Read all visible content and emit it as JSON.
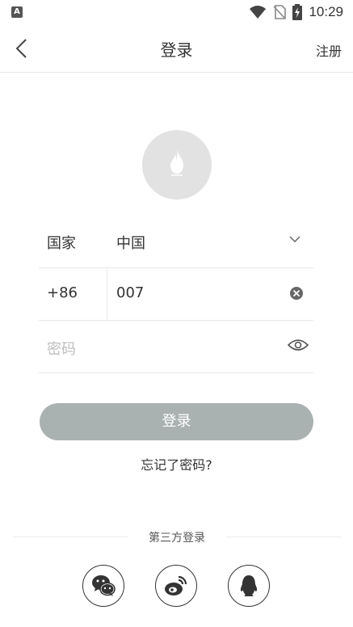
{
  "status_bar": {
    "app_badge": "A",
    "time": "10:29"
  },
  "nav": {
    "title": "登录",
    "register": "注册"
  },
  "form": {
    "country_label": "国家",
    "country_value": "中国",
    "phone_code": "+86",
    "phone_value": "007",
    "password_placeholder": "密码"
  },
  "login_button": "登录",
  "forgot_password": "忘记了密码?",
  "third_party": {
    "label": "第三方登录",
    "options": [
      "wechat-icon",
      "weibo-icon",
      "qq-icon"
    ]
  },
  "colors": {
    "login_button_bg": "#a9b1b1",
    "avatar_bg": "#e2e2e2"
  }
}
